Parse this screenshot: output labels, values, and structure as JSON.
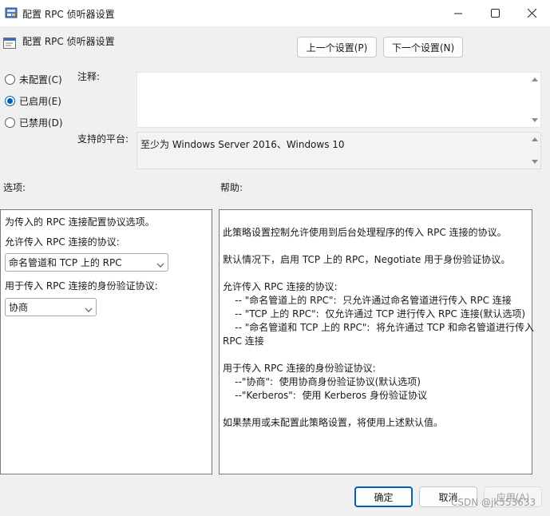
{
  "window": {
    "title": "配置 RPC 侦听器设置",
    "controls": {
      "minimize": "minimize-icon",
      "maximize": "maximize-icon",
      "close": "close-icon"
    }
  },
  "header": {
    "policy_name": "配置 RPC 侦听器设置",
    "prev_button": "上一个设置(P)",
    "next_button": "下一个设置(N)"
  },
  "state": {
    "options": [
      {
        "label": "未配置(C)",
        "checked": false
      },
      {
        "label": "已启用(E)",
        "checked": true
      },
      {
        "label": "已禁用(D)",
        "checked": false
      }
    ]
  },
  "comment": {
    "label": "注释:",
    "value": ""
  },
  "platform": {
    "label": "支持的平台:",
    "value": "至少为 Windows Server 2016、Windows 10"
  },
  "options_section": {
    "label": "选项:",
    "intro": "为传入的 RPC 连接配置协议选项。",
    "protocol_label": "允许传入 RPC 连接的协议:",
    "protocol_value": "命名管道和 TCP 上的 RPC",
    "auth_label": "用于传入 RPC 连接的身份验证协议:",
    "auth_value": "协商"
  },
  "help_section": {
    "label": "帮助:",
    "lines": [
      "此策略设置控制允许使用到后台处理程序的传入 RPC 连接的协议。",
      "",
      "默认情况下，启用 TCP 上的 RPC，Negotiate 用于身份验证协议。",
      "",
      "允许传入 RPC 连接的协议:",
      "    -- \"命名管道上的 RPC\":  只允许通过命名管道进行传入 RPC 连接",
      "    -- \"TCP 上的 RPC\":  仅允许通过 TCP 进行传入 RPC 连接(默认选项)",
      "    -- \"命名管道和 TCP 上的 RPC\":  将允许通过 TCP 和命名管道进行传入",
      "RPC 连接",
      "",
      "用于传入 RPC 连接的身份验证协议:",
      "    --\"协商\":  使用协商身份验证协议(默认选项)",
      "    --\"Kerberos\":  使用 Kerberos 身份验证协议",
      "",
      "如果禁用或未配置此策略设置，将使用上述默认值。"
    ]
  },
  "footer": {
    "ok": "确定",
    "cancel": "取消",
    "apply": "应用(A)",
    "watermark": "CSDN @jk553633"
  },
  "colors": {
    "accent": "#005fb8",
    "window_bg": "#f0f0f0"
  }
}
